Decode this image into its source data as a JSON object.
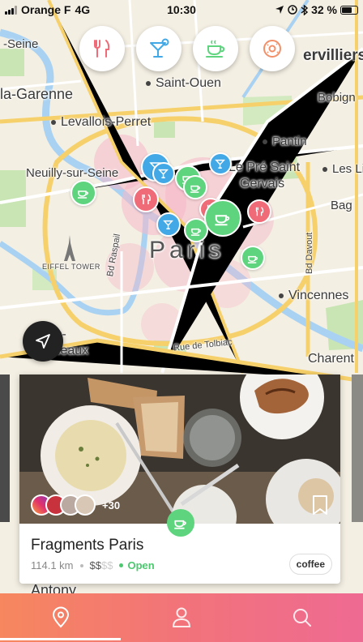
{
  "status_bar": {
    "carrier": "Orange F",
    "network": "4G",
    "time": "10:30",
    "battery": "32 %"
  },
  "map": {
    "labels": {
      "seine": "-Seine",
      "saint_ouen": "Saint-Ouen",
      "aubervilliers": "ervilliers",
      "la_garenne": "la-Garenne",
      "levallois": "Levallois-Perret",
      "bobigny": "Bobign",
      "neuilly": "Neuilly-sur-Seine",
      "pantin": "Pantin",
      "les_lilas": "Les Li",
      "pre_saint_gervais_1": "Le Pré Saint",
      "pre_saint_gervais_2": "Gervais",
      "bagnolet": "Bag",
      "paris": "Paris",
      "eiffel": "EIFFEL TOWER",
      "raspail": "Bd Raspail",
      "davout": "Bd Davout",
      "vincennes": "Vincennes",
      "issy_1": "les-",
      "issy_2": "ineaux",
      "tolbiac": "Rue de Tolbiac",
      "charenton": "Charent",
      "antony": "Antony"
    }
  },
  "filters": [
    {
      "name": "restaurants",
      "icon": "fork-knife-icon",
      "color": "#ef6b78"
    },
    {
      "name": "bars",
      "icon": "cocktail-icon",
      "color": "#43a9e6"
    },
    {
      "name": "coffee",
      "icon": "coffee-cup-icon",
      "color": "#5fd47e"
    },
    {
      "name": "pastries",
      "icon": "donut-icon",
      "color": "#f2906a"
    }
  ],
  "card": {
    "title": "Fragments Paris",
    "distance": "114.1 km",
    "price_active": "$$",
    "price_inactive": "$$",
    "status": "Open",
    "tag": "coffee",
    "followers_more": "+30",
    "category_icon": "coffee-cup-icon"
  },
  "tabbar": [
    {
      "name": "map",
      "icon": "location-pin-icon",
      "active": true
    },
    {
      "name": "profile",
      "icon": "person-icon",
      "active": false
    },
    {
      "name": "search",
      "icon": "search-icon",
      "active": false
    }
  ]
}
